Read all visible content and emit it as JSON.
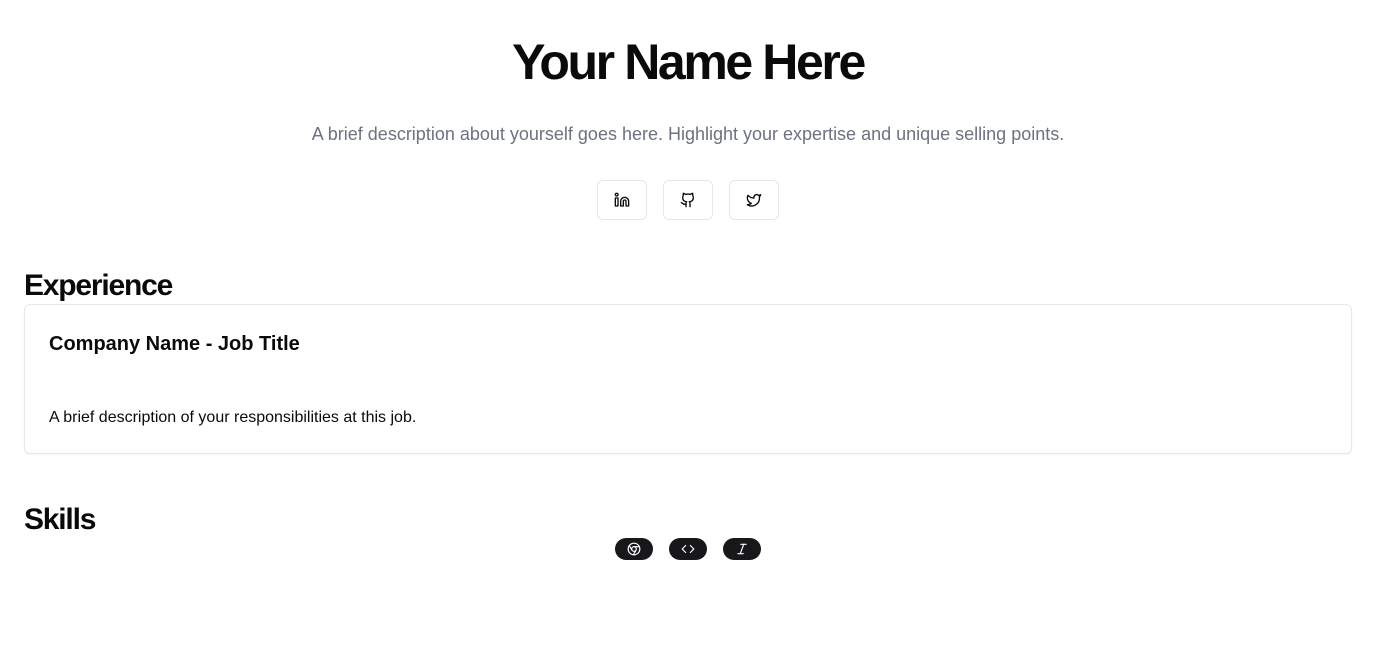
{
  "hero": {
    "name": "Your Name Here",
    "description": "A brief description about yourself goes here. Highlight your expertise and unique selling points."
  },
  "social": [
    {
      "icon": "linkedin-icon"
    },
    {
      "icon": "github-icon"
    },
    {
      "icon": "twitter-icon"
    }
  ],
  "experience": {
    "title": "Experience",
    "items": [
      {
        "heading": "Company Name - Job Title",
        "description": "A brief description of your responsibilities at this job."
      }
    ]
  },
  "skills": {
    "title": "Skills",
    "items": [
      {
        "icon": "chrome-icon"
      },
      {
        "icon": "code-icon"
      },
      {
        "icon": "italic-icon"
      }
    ]
  },
  "colors": {
    "text": "#0a0a0a",
    "muted": "#6b7280",
    "border": "#e5e7eb",
    "badge": "#18181b"
  }
}
